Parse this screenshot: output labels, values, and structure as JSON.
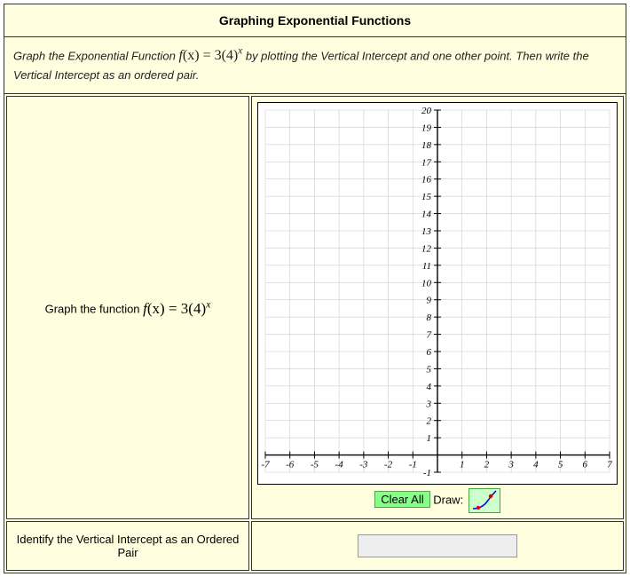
{
  "title": "Graphing Exponential Functions",
  "instructions_pre": "Graph the Exponential Function ",
  "instructions_post": " by plotting the Vertical Intercept and one other point. Then write the Vertical Intercept as an ordered pair.",
  "row1_label_pre": "Graph the function ",
  "formula_f": "f",
  "formula_x_open": "(x) = 3(4)",
  "formula_exp": "x",
  "clear_label": "Clear All",
  "draw_label": "Draw:",
  "row2_label": "Identify the Vertical Intercept as an Ordered Pair",
  "answer_value": "",
  "chart_data": {
    "type": "scatter",
    "title": "",
    "xlabel": "",
    "ylabel": "",
    "xlim": [
      -7,
      7
    ],
    "ylim": [
      -1,
      20
    ],
    "xticks": [
      -7,
      -6,
      -5,
      -4,
      -3,
      -2,
      -1,
      1,
      2,
      3,
      4,
      5,
      6,
      7
    ],
    "yticks": [
      -1,
      1,
      2,
      3,
      4,
      5,
      6,
      7,
      8,
      9,
      10,
      11,
      12,
      13,
      14,
      15,
      16,
      17,
      18,
      19,
      20
    ],
    "series": []
  }
}
